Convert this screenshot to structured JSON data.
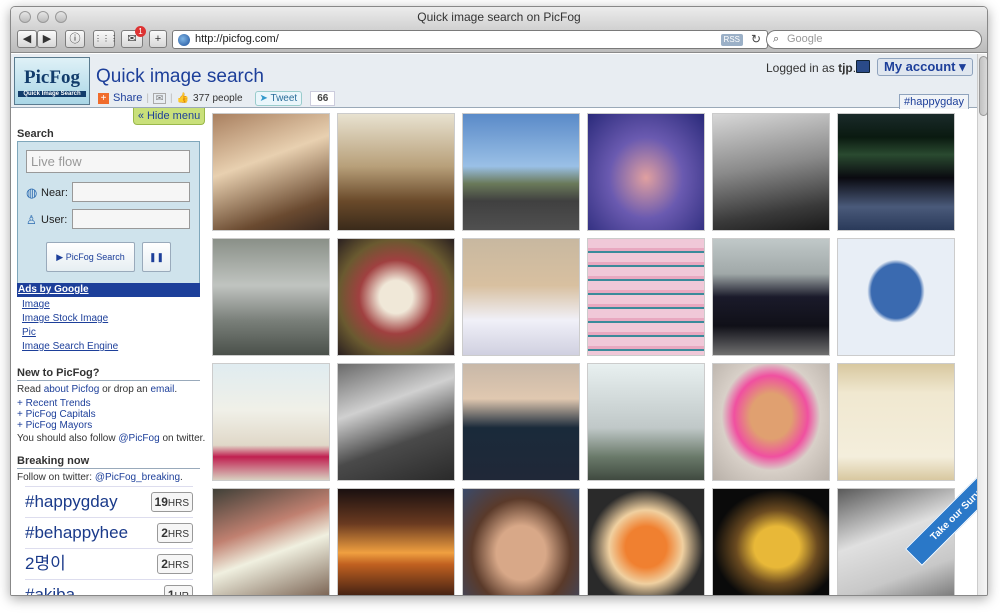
{
  "window": {
    "title": "Quick image search on PicFog"
  },
  "toolbar": {
    "back": "◀",
    "forward": "▶",
    "info": "ⓘ",
    "grid": "⋮⋮⋮",
    "mail": "✉",
    "mail_badge": "1",
    "add": "+",
    "url": "http://picfog.com/",
    "rss": "RSS",
    "reload": "↻",
    "search_placeholder": "Google"
  },
  "header": {
    "logo_text": "PicFog",
    "logo_sub": "Quick Image Search",
    "title": "Quick image search",
    "share": "Share",
    "like_count": "377 people",
    "tweet": "Tweet",
    "tweet_count": "66",
    "logged_in_prefix": "Logged in as",
    "username": "tjp",
    "period": ".",
    "account": "My account ▾",
    "tag": "#happygday"
  },
  "sidebar": {
    "hide_menu": "« Hide menu",
    "search_heading": "Search",
    "search_placeholder": "Live flow",
    "near_label": "Near:",
    "user_label": "User:",
    "search_button": "PicFog Search",
    "pause": "❚❚",
    "ads_heading": "Ads by Google",
    "ads": [
      "Image",
      "Image Stock Image",
      "Pic",
      "Image Search Engine"
    ],
    "new_heading": "New to PicFog?",
    "read_prefix": "Read",
    "about_link": "about Picfog",
    "or_text": "or drop an",
    "email_link": "email",
    "period": ".",
    "links": [
      "+ Recent Trends",
      "+ PicFog Capitals",
      "+ PicFog Mayors"
    ],
    "follow_prefix": "You should also follow",
    "follow_handle": "@PicFog",
    "follow_suffix": "on twitter.",
    "breaking_heading": "Breaking now",
    "breaking_prefix": "Follow on twitter:",
    "breaking_handle": "@PicFog_breaking",
    "breaking_suffix": ".",
    "trends": [
      {
        "tag": "#happygday",
        "num": "19",
        "unit": "HRS"
      },
      {
        "tag": "#behappyhee",
        "num": "2",
        "unit": "HRS"
      },
      {
        "tag": "2명이",
        "num": "2",
        "unit": "HRS"
      },
      {
        "tag": "#akiba",
        "num": "1",
        "unit": "HR"
      }
    ]
  },
  "survey": "Take our Survey",
  "colors": {
    "accent": "#1d3f9a",
    "header_bg": "#e8edf2",
    "search_panel": "#cfe3ec",
    "hide_menu": "#c9e07a"
  }
}
